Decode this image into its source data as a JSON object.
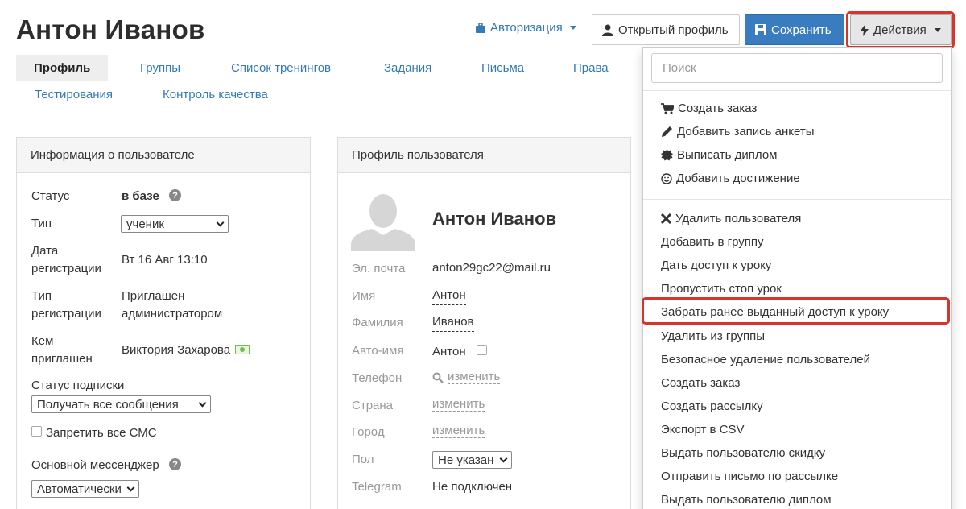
{
  "header": {
    "title": "Антон Иванов",
    "auth_label": "Авторизация",
    "profile_button": "Открытый профиль",
    "save_button": "Сохранить",
    "actions_button": "Действия"
  },
  "tabs": [
    "Профиль",
    "Группы",
    "Список тренингов",
    "Задания",
    "Письма",
    "Права",
    "Тестирования",
    "Контроль качества"
  ],
  "user_info": {
    "title": "Информация о пользователе",
    "status_label": "Статус",
    "status_value": "в базе",
    "type_label": "Тип",
    "type_value": "ученик",
    "reg_date_label_1": "Дата",
    "reg_date_label_2": "регистрации",
    "reg_date_value": "Вт 16 Авг 13:10",
    "reg_type_label_1": "Тип",
    "reg_type_label_2": "регистрации",
    "reg_type_value_1": "Приглашен",
    "reg_type_value_2": "администратором",
    "invited_label_1": "Кем",
    "invited_label_2": "приглашен",
    "invited_value": "Виктория Захарова",
    "subscription_label": "Статус подписки",
    "subscription_value": "Получать все сообщения",
    "sms_label": "Запретить все СМС",
    "messenger_label": "Основной мессенджер",
    "messenger_value": "Автоматически"
  },
  "profile": {
    "title": "Профиль пользователя",
    "name": "Антон Иванов",
    "email_label": "Эл. почта",
    "email_value": "anton29gc22@mail.ru",
    "first_name_label": "Имя",
    "first_name_value": "Антон",
    "last_name_label": "Фамилия",
    "last_name_value": "Иванов",
    "auto_name_label": "Авто-имя",
    "auto_name_value": "Антон",
    "phone_label": "Телефон",
    "phone_value": "изменить",
    "country_label": "Страна",
    "country_value": "изменить",
    "city_label": "Город",
    "city_value": "изменить",
    "gender_label": "Пол",
    "gender_value": "Не указан",
    "telegram_label": "Telegram",
    "telegram_value": "Не подключен"
  },
  "actions_menu": {
    "search_placeholder": "Поиск",
    "group1": [
      "Создать заказ",
      "Добавить запись анкеты",
      "Выписать диплом",
      "Добавить достижение"
    ],
    "group2": [
      "Удалить пользователя",
      "Добавить в группу",
      "Дать доступ к уроку",
      "Пропустить стоп урок",
      "Забрать ранее выданный доступ к уроку",
      "Удалить из группы",
      "Безопасное удаление пользователей",
      "Создать заказ",
      "Создать рассылку",
      "Экспорт в CSV",
      "Выдать пользователю скидку",
      "Отправить письмо по рассылке",
      "Выдать пользователю диплом"
    ]
  },
  "colors": {
    "link": "#337ab7",
    "save_button": "#3a7cc0",
    "highlight": "#d9342b"
  }
}
